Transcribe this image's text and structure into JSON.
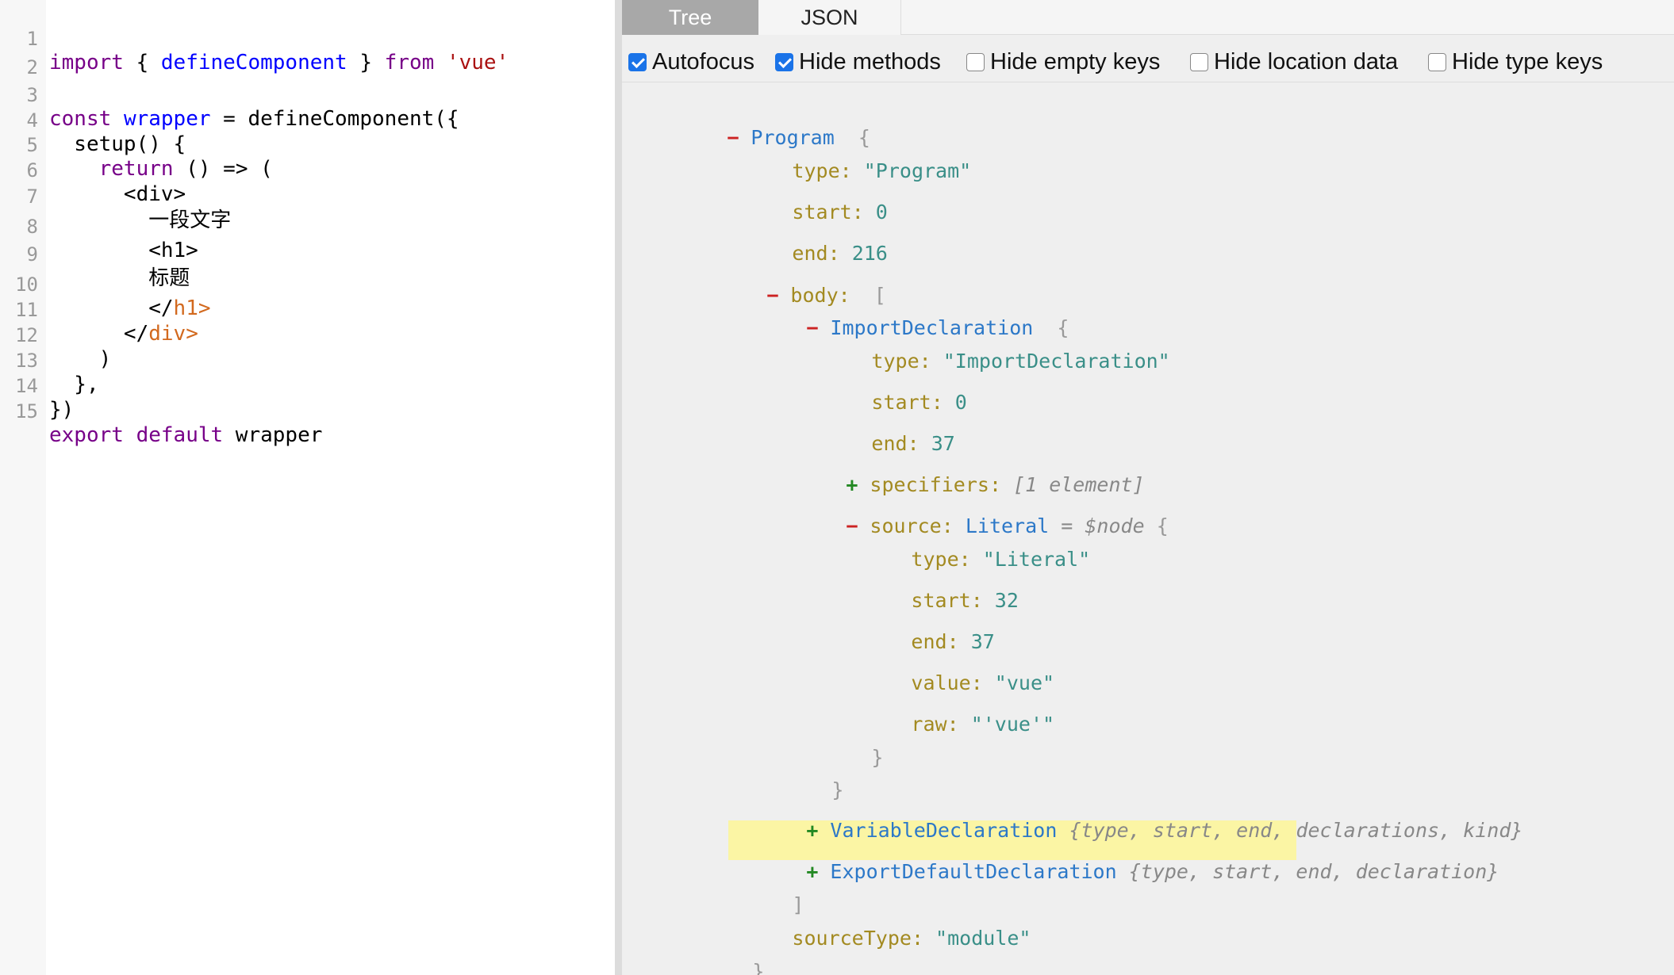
{
  "editor": {
    "lines": [
      {
        "n": "1"
      },
      {
        "n": "2"
      },
      {
        "n": "3"
      },
      {
        "n": "4"
      },
      {
        "n": "5"
      },
      {
        "n": "6"
      },
      {
        "n": "7"
      },
      {
        "n": "8"
      },
      {
        "n": "9"
      },
      {
        "n": "10"
      },
      {
        "n": "11"
      },
      {
        "n": "12"
      },
      {
        "n": "13"
      },
      {
        "n": "14"
      },
      {
        "n": "15"
      }
    ],
    "code": {
      "l1": {
        "import": "import",
        "open": " { ",
        "fn": "defineComponent",
        "close": " } ",
        "from": "from",
        "sp": " ",
        "str": "'vue'"
      },
      "l3": {
        "const": "const",
        "sp": " ",
        "name": "wrapper",
        "rest": " = defineComponent({"
      },
      "l4": {
        "text": "  setup() {"
      },
      "l5": {
        "ret": "    return",
        "rest": " () => ("
      },
      "l6": {
        "text": "      <div>"
      },
      "l7": {
        "text": "        一段文字"
      },
      "l8": {
        "text": "        <h1>"
      },
      "l9": {
        "text": "        标题"
      },
      "l10": {
        "lt": "        </",
        "tag": "h1>"
      },
      "l11": {
        "lt": "      </",
        "tag": "div>"
      },
      "l12": {
        "text": "    )"
      },
      "l13": {
        "text": "  },"
      },
      "l14": {
        "text": "})"
      },
      "l15": {
        "export": "export",
        "sp1": " ",
        "default": "default",
        "rest": " wrapper"
      }
    }
  },
  "tabs": {
    "tree": "Tree",
    "json": "JSON"
  },
  "options": {
    "autofocus": "Autofocus",
    "hide_methods": "Hide methods",
    "hide_empty_keys": "Hide empty keys",
    "hide_location_data": "Hide location data",
    "hide_type_keys": "Hide type keys"
  },
  "tree": {
    "program": {
      "name": "Program",
      "brace": "{",
      "type_val": "\"Program\"",
      "start_val": "0",
      "end_val": "216",
      "close": "}"
    },
    "keys": {
      "type": "type",
      "start": "start",
      "end": "end",
      "body": "body",
      "specifiers": "specifiers",
      "source": "source",
      "value": "value",
      "raw": "raw",
      "sourceType": "sourceType"
    },
    "body_open": "[",
    "body_close": "]",
    "import_decl": {
      "name": "ImportDeclaration",
      "brace": "{",
      "type_val": "\"ImportDeclaration\"",
      "start_val": "0",
      "end_val": "37",
      "close": "}"
    },
    "specifiers_summary": "[1 element]",
    "source": {
      "name": "Literal",
      "tag": "= $node",
      "brace": "{",
      "type_val": "\"Literal\"",
      "start_val": "32",
      "end_val": "37",
      "value_val": "\"vue\"",
      "raw_val": "\"'vue'\"",
      "close": "}"
    },
    "variable_decl": {
      "name": "VariableDeclaration",
      "summary": "{type, start, end, declarations, kind}"
    },
    "export_decl": {
      "name": "ExportDefaultDeclaration",
      "summary": "{type, start, end, declaration}"
    },
    "source_type_val": "\"module\""
  },
  "colors": {
    "keyword": "#770088",
    "definition": "#0000ff",
    "string": "#aa1111",
    "highlight": "#fbf5a4",
    "checkbox": "#1a73e8"
  }
}
